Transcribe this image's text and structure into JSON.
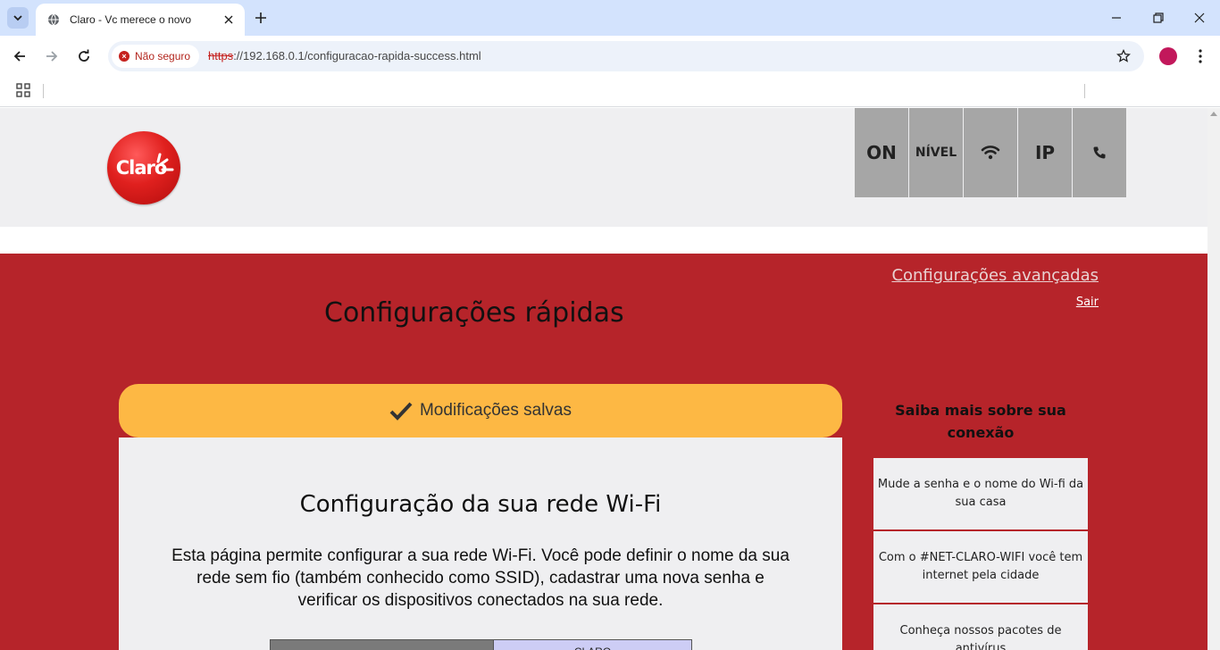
{
  "browser": {
    "tab_title": "Claro - Vc merece o novo",
    "security_label": "Não seguro",
    "url_scheme": "https",
    "url_rest": "://192.168.0.1/configuracao-rapida-success.html"
  },
  "header": {
    "logo_text": "Claro",
    "status": [
      {
        "label": "ON"
      },
      {
        "label": "NÍVEL"
      },
      {
        "icon": "wifi-icon"
      },
      {
        "label": "IP"
      },
      {
        "icon": "phone-icon"
      }
    ]
  },
  "nav": {
    "advanced_settings": "Configurações avançadas",
    "logout": "Sair"
  },
  "main": {
    "title": "Configurações rápidas",
    "banner": "Modificações salvas",
    "card_title": "Configuração da sua rede Wi-Fi",
    "card_desc": "Esta página permite configurar a sua rede Wi-Fi. Você pode definir o nome da sua rede sem fio (também conhecido como SSID), cadastrar uma nova senha e verificar os dispositivos conectados na sua rede.",
    "tab_b_label": "CLARO"
  },
  "sidebar": {
    "title": "Saiba mais sobre sua conexão",
    "items": [
      {
        "label": "Mude a senha e o nome do Wi-fi da sua casa"
      },
      {
        "label": "Com o #NET-CLARO-WIFI você tem internet pela cidade"
      },
      {
        "label": "Conheça nossos pacotes de antivírus"
      }
    ]
  },
  "colors": {
    "brand_red": "#b6242a",
    "banner_yellow": "#fdb844",
    "header_gray": "#efeff1"
  }
}
